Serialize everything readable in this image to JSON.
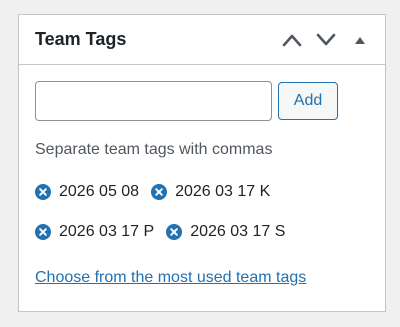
{
  "panel": {
    "title": "Team Tags",
    "controls": {
      "move_up": "chevron-up-icon",
      "move_down": "chevron-down-icon",
      "toggle": "triangle-up-icon"
    }
  },
  "input": {
    "value": "",
    "placeholder": ""
  },
  "add_button_label": "Add",
  "help_text": "Separate team tags with commas",
  "tags": [
    {
      "label": "2026 05 08"
    },
    {
      "label": "2026 03 17 K"
    },
    {
      "label": "2026 03 17 P"
    },
    {
      "label": "2026 03 17 S"
    }
  ],
  "most_used_link": "Choose from the most used team tags",
  "colors": {
    "accent": "#2271b1",
    "text": "#1d2327",
    "muted": "#50575e",
    "border": "#c3c4c7",
    "background": "#f0f0f1"
  }
}
